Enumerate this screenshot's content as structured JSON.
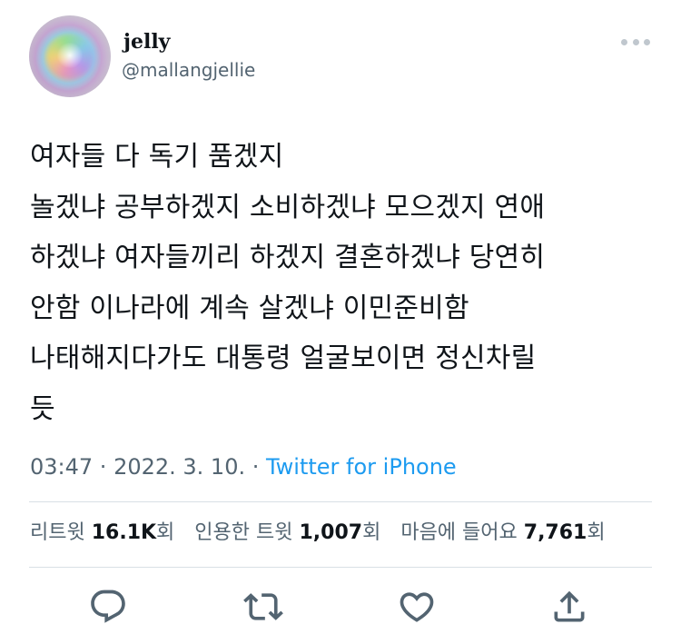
{
  "author": {
    "display_name": "jelly",
    "handle": "@mallangjellie"
  },
  "tweet": {
    "lines": [
      "여자들 다 독기 품겠지",
      "놀겠냐 공부하겠지 소비하겠냐 모으겠지 연애",
      "하겠냐 여자들끼리 하겠지 결혼하겠냐 당연히",
      "안함 이나라에 계속 살겠냐 이민준비함",
      "나태해지다가도 대통령 얼굴보이면 정신차릴",
      "듯"
    ]
  },
  "meta": {
    "time": "03:47",
    "separator": " · ",
    "date": "2022. 3. 10.",
    "source": "Twitter for iPhone"
  },
  "stats": {
    "retweets_label": "리트윗 ",
    "retweets": "16.1K",
    "retweets_unit": "회",
    "quotes_label": "인용한 트윗 ",
    "quotes": "1,007",
    "quotes_unit": "회",
    "likes_label": "마음에 들어요 ",
    "likes": "7,761",
    "likes_unit": "회"
  },
  "colors": {
    "text": "#0f1419",
    "secondary": "#536471",
    "link": "#1d9bf0",
    "icon": "#536471",
    "divider": "#d9e0e5"
  },
  "icons": {
    "more": "more-dots-icon",
    "reply": "reply-icon",
    "retweet": "retweet-icon",
    "like": "heart-icon",
    "share": "share-icon"
  }
}
